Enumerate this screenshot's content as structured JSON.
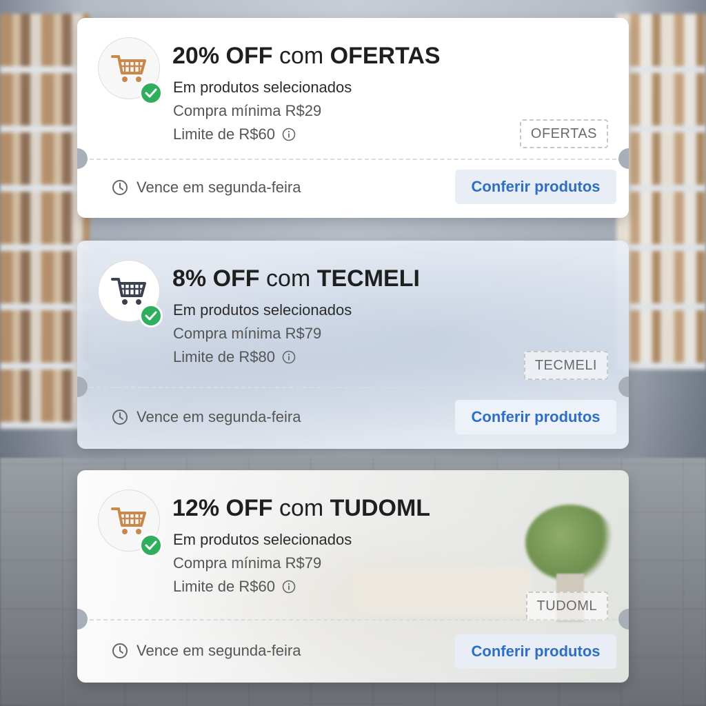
{
  "coupons": [
    {
      "discount": "20% OFF",
      "connector": "com",
      "code_title": "OFERTAS",
      "scope": "Em produtos selecionados",
      "minimum": "Compra mínima R$29",
      "limit": "Limite de R$60",
      "code_tag": "OFERTAS",
      "expiry": "Vence em segunda-feira",
      "cta": "Conferir produtos",
      "icon": "shopping-cart-icon",
      "icon_color": "#c8874b"
    },
    {
      "discount": "8% OFF",
      "connector": "com",
      "code_title": "TECMELI",
      "scope": "Em produtos selecionados",
      "minimum": "Compra mínima R$79",
      "limit": "Limite de R$80",
      "code_tag": "TECMELI",
      "expiry": "Vence em segunda-feira",
      "cta": "Conferir produtos",
      "icon": "shopping-cart-icon",
      "icon_color": "#3b4150"
    },
    {
      "discount": "12% OFF",
      "connector": "com",
      "code_title": "TUDOML",
      "scope": "Em produtos selecionados",
      "minimum": "Compra mínima R$79",
      "limit": "Limite de R$60",
      "code_tag": "TUDOML",
      "expiry": "Vence em segunda-feira",
      "cta": "Conferir produtos",
      "icon": "shopping-cart-icon",
      "icon_color": "#c8874b"
    }
  ],
  "colors": {
    "check_green": "#2fae5d",
    "cta_blue": "#2e6fc4",
    "cta_bg": "#e9eef6"
  }
}
